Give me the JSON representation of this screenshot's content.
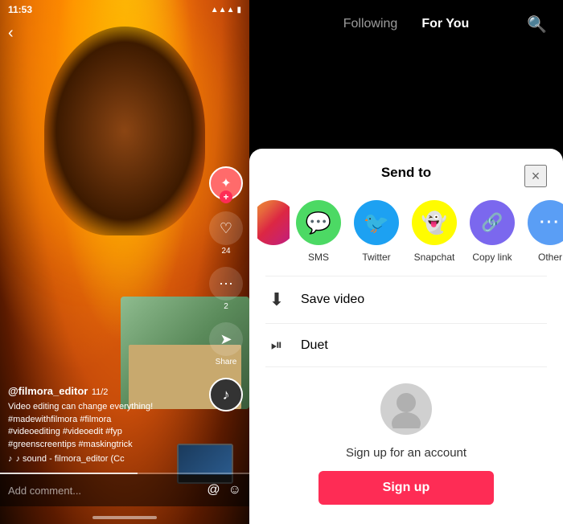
{
  "left": {
    "time": "11:53",
    "back_label": "‹",
    "username": "@filmora_editor",
    "date": "11/2",
    "description": "Video editing can change everything!\n#madewithfilmora #filmora\n#videoediting #videoedit #fyp\n#greenscreentips #maskingtrick",
    "music": "♪ sound - filmora_editor (Cc",
    "comment_placeholder": "Add comment...",
    "action_counts": {
      "heart": "24",
      "comment": "2",
      "share": "Share"
    }
  },
  "right": {
    "nav": {
      "following": "Following",
      "for_you": "For You",
      "search_icon": "🔍"
    },
    "sheet": {
      "title": "Send to",
      "close": "×",
      "share_items": [
        {
          "label": "SMS",
          "color": "#4cd964",
          "icon": "💬"
        },
        {
          "label": "Twitter",
          "color": "#1da1f2",
          "icon": "🐦"
        },
        {
          "label": "Snapchat",
          "color": "#fffc00",
          "icon": "👻"
        },
        {
          "label": "Copy link",
          "color": "#7b68ee",
          "icon": "🔗"
        },
        {
          "label": "Other",
          "color": "#5a9ef5",
          "icon": "···"
        }
      ],
      "save_video": "Save video",
      "duet": "Duet",
      "signup_prompt": "Sign up for an account",
      "signup_btn": "Sign up"
    }
  }
}
